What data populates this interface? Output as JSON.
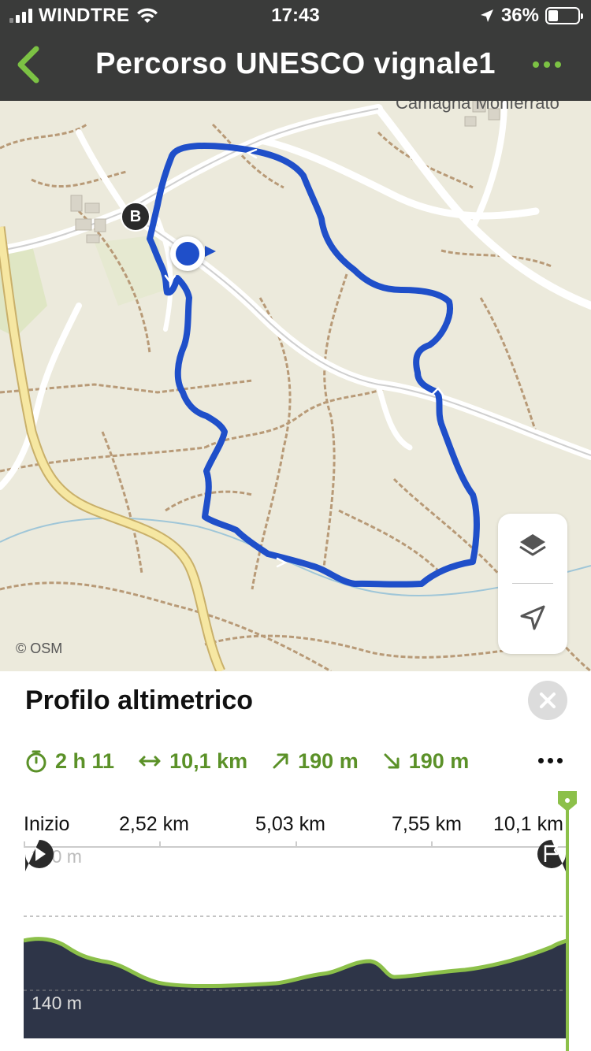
{
  "status_bar": {
    "carrier": "WINDTRE",
    "time": "17:43",
    "battery_percent": "36%",
    "battery_level": 0.36
  },
  "nav": {
    "title": "Percorso UNESCO vignale1",
    "back_icon": "chevron-left-icon",
    "more_icon": "more-horizontal-icon"
  },
  "map": {
    "town_label": "Camagna Monferrato",
    "attribution": "© OSM",
    "marker_b": "B",
    "route_color": "#1f4fc9",
    "controls": [
      "layers-icon",
      "locate-arrow-icon"
    ]
  },
  "panel": {
    "title": "Profilo altimetrico",
    "stats": {
      "duration": "2 h 11",
      "distance": "10,1 km",
      "ascent": "190 m",
      "descent": "190 m"
    },
    "accent_color": "#5b9128",
    "axis_labels": [
      "Inizio",
      "2,52 km",
      "5,03 km",
      "7,55 km",
      "10,1 km"
    ],
    "elevation_labels": {
      "high": "390 m",
      "low": "140 m"
    }
  }
}
